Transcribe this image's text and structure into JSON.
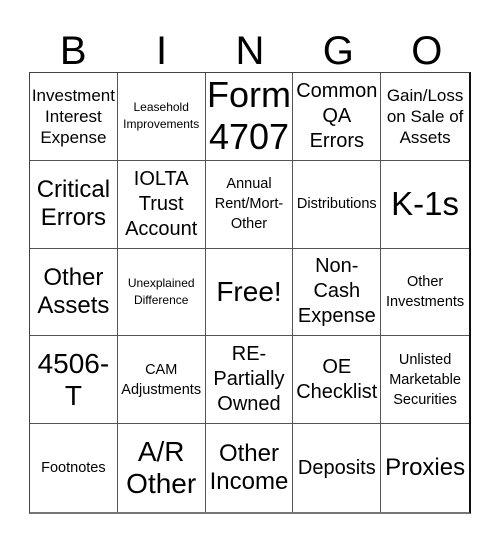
{
  "header": {
    "letters": [
      "B",
      "I",
      "N",
      "G",
      "O"
    ]
  },
  "cells": [
    {
      "text": "Investment Interest Expense"
    },
    {
      "text": "Leasehold Improvements"
    },
    {
      "text": "Form 4707"
    },
    {
      "text": "Common QA Errors"
    },
    {
      "text": "Gain/Loss on Sale of Assets"
    },
    {
      "text": "Critical Errors"
    },
    {
      "text": "IOLTA Trust Account"
    },
    {
      "text": "Annual Rent/Mort-Other"
    },
    {
      "text": "Distributions"
    },
    {
      "text": "K-1s"
    },
    {
      "text": "Other Assets"
    },
    {
      "text": "Unexplained Difference"
    },
    {
      "text": "Free!"
    },
    {
      "text": "Non-Cash Expense"
    },
    {
      "text": "Other Investments"
    },
    {
      "text": "4506-T"
    },
    {
      "text": "CAM Adjustments"
    },
    {
      "text": "RE-Partially Owned"
    },
    {
      "text": "OE Checklist"
    },
    {
      "text": "Unlisted Marketable Securities"
    },
    {
      "text": "Footnotes"
    },
    {
      "text": "A/R Other"
    },
    {
      "text": "Other Income"
    },
    {
      "text": "Deposits"
    },
    {
      "text": "Proxies"
    }
  ]
}
